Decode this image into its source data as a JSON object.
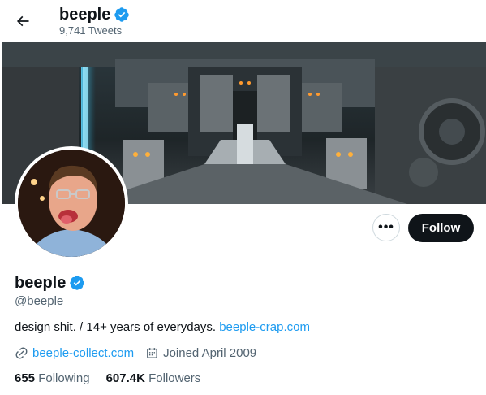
{
  "header": {
    "back_icon": "arrow-left-icon",
    "title": "beeple",
    "tweet_count": "9,741 Tweets"
  },
  "profile": {
    "display_name": "beeple",
    "handle": "@beeple",
    "bio_text": "design shit. / 14+ years of everydays. ",
    "bio_link": "beeple-crap.com",
    "website": "beeple-collect.com",
    "joined": "Joined April 2009",
    "following_count": "655",
    "following_label": " Following",
    "followers_count": "607.4K",
    "followers_label": " Followers"
  },
  "actions": {
    "more_label": "•••",
    "follow_label": "Follow"
  },
  "colors": {
    "accent": "#1d9bf0",
    "text": "#0f1419",
    "secondary": "#536471",
    "follow_bg": "#0f1419"
  }
}
